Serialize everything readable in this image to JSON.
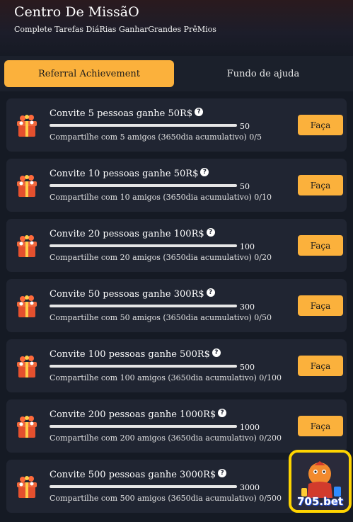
{
  "header": {
    "title": "Centro De MissãO",
    "subtitle": "Complete Tarefas DiáRias GanharGrandes PrêMios"
  },
  "tabs": [
    {
      "label": "Referral Achievement",
      "active": true
    },
    {
      "label": "Fundo de ajuda",
      "active": false
    }
  ],
  "missions": [
    {
      "title": "Convite 5 pessoas ganhe 50R$",
      "target": "50",
      "desc": "Compartilhe com 5 amigos (3650dia acumulativo) 0/5",
      "progress": 0,
      "button": "Faça"
    },
    {
      "title": "Convite 10 pessoas ganhe 50R$",
      "target": "50",
      "desc": "Compartilhe com 10 amigos (3650dia acumulativo) 0/10",
      "progress": 0,
      "button": "Faça"
    },
    {
      "title": "Convite 20 pessoas ganhe 100R$",
      "target": "100",
      "desc": "Compartilhe com 20 amigos (3650dia acumulativo) 0/20",
      "progress": 0,
      "button": "Faça"
    },
    {
      "title": "Convite 50 pessoas ganhe 300R$",
      "target": "300",
      "desc": "Compartilhe com 50 amigos (3650dia acumulativo) 0/50",
      "progress": 0,
      "button": "Faça"
    },
    {
      "title": "Convite 100 pessoas ganhe 500R$",
      "target": "500",
      "desc": "Compartilhe com 100 amigos (3650dia acumulativo) 0/100",
      "progress": 0,
      "button": "Faça"
    },
    {
      "title": "Convite 200 pessoas ganhe 1000R$",
      "target": "1000",
      "desc": "Compartilhe com 200 amigos (3650dia acumulativo) 0/200",
      "progress": 0,
      "button": "Faça"
    },
    {
      "title": "Convite 500 pessoas ganhe 3000R$",
      "target": "3000",
      "desc": "Compartilhe com 500 amigos (3650dia acumulativo) 0/500",
      "progress": 0,
      "button": null
    }
  ],
  "logo": {
    "text": "705.bet"
  },
  "colors": {
    "accent": "#fbb13c",
    "background": "#151a24",
    "card": "#202532"
  }
}
